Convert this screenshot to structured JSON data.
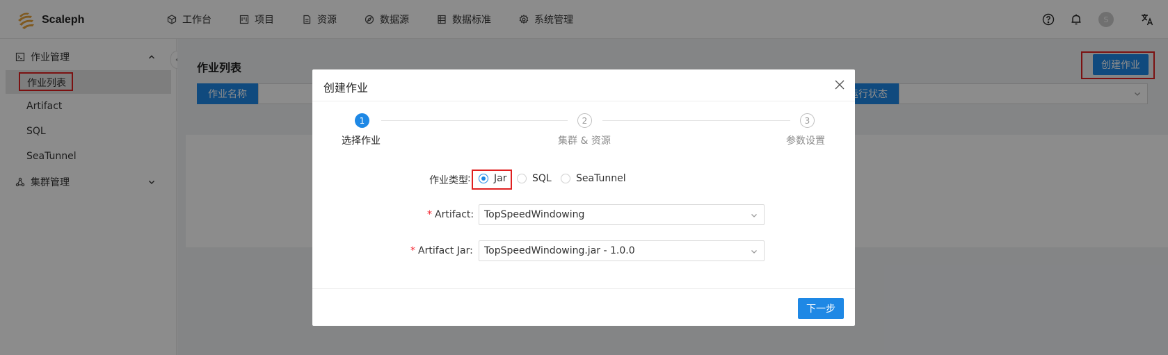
{
  "app": {
    "name": "Scaleph"
  },
  "topnav": [
    {
      "label": "工作台",
      "icon": "cube-icon"
    },
    {
      "label": "项目",
      "icon": "project-icon"
    },
    {
      "label": "资源",
      "icon": "file-icon"
    },
    {
      "label": "数据源",
      "icon": "compass-icon"
    },
    {
      "label": "数据标准",
      "icon": "table-icon"
    },
    {
      "label": "系统管理",
      "icon": "gear-icon"
    }
  ],
  "header": {
    "avatar_letter": "S"
  },
  "sidebar": {
    "group1": "作业管理",
    "items": [
      "作业列表",
      "Artifact",
      "SQL",
      "SeaTunnel"
    ],
    "group2": "集群管理"
  },
  "page": {
    "title": "作业列表",
    "filter_name_label": "作业名称",
    "filter_status_label": "运行状态",
    "create_button": "创建作业"
  },
  "modal": {
    "title": "创建作业",
    "steps": [
      {
        "num": "1",
        "label": "选择作业",
        "status": "active"
      },
      {
        "num": "2",
        "label": "集群 & 资源",
        "status": "wait"
      },
      {
        "num": "3",
        "label": "参数设置",
        "status": "wait"
      }
    ],
    "job_type_label": "作业类型",
    "job_type_options": [
      "Jar",
      "SQL",
      "SeaTunnel"
    ],
    "job_type_selected": "Jar",
    "artifact_label": "Artifact",
    "artifact_value": "TopSpeedWindowing",
    "artifact_jar_label": "Artifact Jar",
    "artifact_jar_value": "TopSpeedWindowing.jar - 1.0.0",
    "next_button": "下一步"
  },
  "colors": {
    "primary": "#1e88e5",
    "highlight": "#e02020",
    "mask": "rgba(0,0,0,0.45)"
  }
}
